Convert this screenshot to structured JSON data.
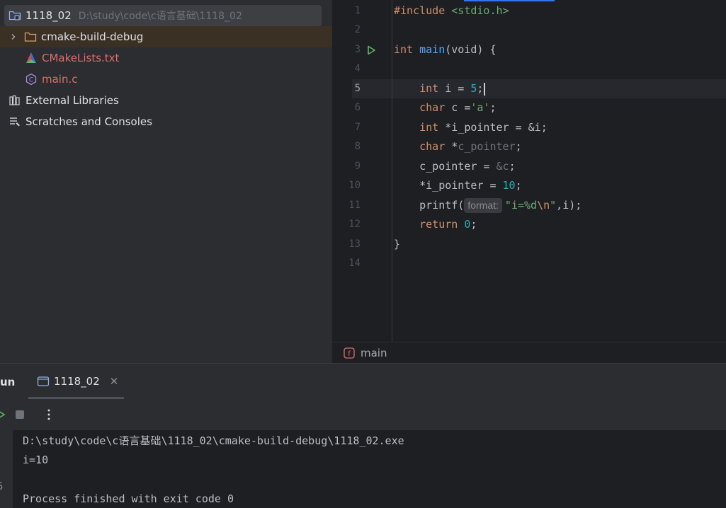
{
  "project": {
    "root_name": "1118_02",
    "root_path": "D:\\study\\code\\c语言基础\\1118_02",
    "items": [
      {
        "label": "cmake-build-debug",
        "icon": "folder-icon"
      },
      {
        "label": "CMakeLists.txt",
        "icon": "cmake-icon"
      },
      {
        "label": "main.c",
        "icon": "c-file-icon"
      },
      {
        "label": "External Libraries",
        "icon": "library-icon"
      },
      {
        "label": "Scratches and Consoles",
        "icon": "scratches-icon"
      }
    ]
  },
  "editor": {
    "line_numbers": [
      "1",
      "2",
      "3",
      "4",
      "5",
      "6",
      "7",
      "8",
      "9",
      "10",
      "11",
      "12",
      "13",
      "14"
    ],
    "current_line": "5",
    "code": {
      "l1_directive": "#include",
      "l1_header": " <stdio.h>",
      "l3_type": "int",
      "l3_fn": "main",
      "l3_rest": "(void) {",
      "l5_type": "int",
      "l5_var": " i = ",
      "l5_num": "5",
      "l5_end": ";",
      "l6_type": "char",
      "l6_var": " c =",
      "l6_str": "'a'",
      "l6_end": ";",
      "l7_type": "int",
      "l7_rest": " *i_pointer = &i;",
      "l8_type": "char",
      "l8_star": " *",
      "l8_var": "c_pointer",
      "l8_end": ";",
      "l9_var": "c_pointer = ",
      "l9_addr": "&c",
      "l9_end": ";",
      "l10_var": "*i_pointer = ",
      "l10_num": "10",
      "l10_end": ";",
      "l11_fn": "printf(",
      "l11_hint": "format:",
      "l11_str1": "\"i=%d",
      "l11_esc": "\\n",
      "l11_str2": "\"",
      "l11_end": ",i);",
      "l12_kw": "return",
      "l12_num": "0",
      "l12_end": ";",
      "l13": "}"
    },
    "breadcrumb": "main"
  },
  "run": {
    "title": "un",
    "tab_label": "1118_02",
    "console": [
      "D:\\study\\code\\c语言基础\\1118_02\\cmake-build-debug\\1118_02.exe",
      "i=10",
      "",
      "Process finished with exit code 0"
    ],
    "gutter_digit": "5"
  },
  "colors": {
    "keyword": "#cf8e6d",
    "function": "#56a8f5",
    "string": "#6aab73",
    "number": "#2aacb8",
    "run_green": "#5fb865"
  }
}
